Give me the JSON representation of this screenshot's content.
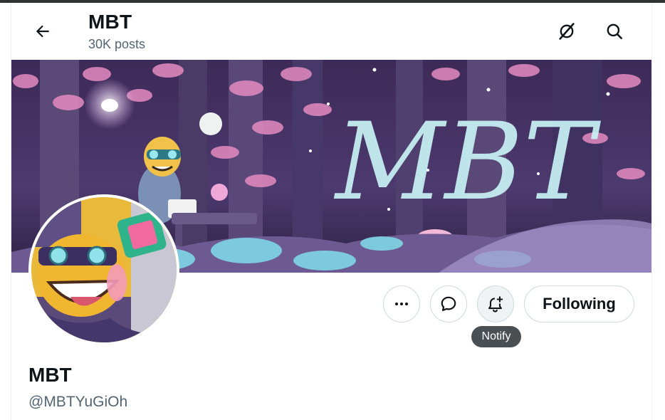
{
  "header": {
    "title": "MBT",
    "post_count": "30K posts",
    "back_icon": "arrow-left-icon",
    "grok_icon": "grok-icon",
    "search_icon": "search-icon"
  },
  "banner": {
    "wordmark": "MBT",
    "colors": {
      "sky": "#3a2752",
      "foliage": "#e48bc0",
      "ground": "#7fd6e6"
    }
  },
  "actions": {
    "more_icon": "more-dots-icon",
    "message_icon": "message-bubble-icon",
    "notify_icon": "bell-plus-icon",
    "following_label": "Following",
    "notify_tooltip": "Notify"
  },
  "profile": {
    "display_name": "MBT",
    "handle": "@MBTYuGiOh"
  }
}
